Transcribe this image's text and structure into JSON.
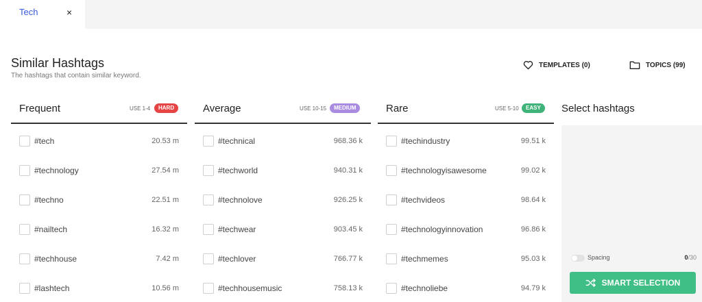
{
  "tab": {
    "label": "Tech",
    "close": "×"
  },
  "header": {
    "title": "Similar Hashtags",
    "subtitle": "The hashtags that contain similar keyword.",
    "templates_label": "TEMPLATES (0)",
    "topics_label": "TOPICS (99)"
  },
  "columns": [
    {
      "title": "Frequent",
      "use": "USE 1-4",
      "badge": "HARD",
      "badge_color": "#e64545",
      "items": [
        {
          "tag": "#tech",
          "count": "20.53 m"
        },
        {
          "tag": "#technology",
          "count": "27.54 m"
        },
        {
          "tag": "#techno",
          "count": "22.51 m"
        },
        {
          "tag": "#nailtech",
          "count": "16.32 m"
        },
        {
          "tag": "#techhouse",
          "count": "7.42 m"
        },
        {
          "tag": "#lashtech",
          "count": "10.56 m"
        }
      ]
    },
    {
      "title": "Average",
      "use": "USE 10-15",
      "badge": "MEDIUM",
      "badge_color": "#a98be0",
      "items": [
        {
          "tag": "#technical",
          "count": "968.36 k"
        },
        {
          "tag": "#techworld",
          "count": "940.31 k"
        },
        {
          "tag": "#technolove",
          "count": "926.25 k"
        },
        {
          "tag": "#techwear",
          "count": "903.45 k"
        },
        {
          "tag": "#techlover",
          "count": "766.77 k"
        },
        {
          "tag": "#techhousemusic",
          "count": "758.13 k"
        }
      ]
    },
    {
      "title": "Rare",
      "use": "USE 5-10",
      "badge": "EASY",
      "badge_color": "#3fb37a",
      "items": [
        {
          "tag": "#techindustry",
          "count": "99.51 k"
        },
        {
          "tag": "#technologyisawesome",
          "count": "99.02 k"
        },
        {
          "tag": "#techvideos",
          "count": "98.64 k"
        },
        {
          "tag": "#technologyinnovation",
          "count": "96.86 k"
        },
        {
          "tag": "#techmemes",
          "count": "95.03 k"
        },
        {
          "tag": "#technoliebe",
          "count": "94.79 k"
        }
      ]
    }
  ],
  "select": {
    "title": "Select hashtags",
    "spacing_label": "Spacing",
    "selected_count": "0",
    "max_count": "/30",
    "smart_label": "SMART SELECTION"
  },
  "icons": {
    "templates": "heart-icon",
    "topics": "folder-icon",
    "smart": "shuffle-icon"
  }
}
